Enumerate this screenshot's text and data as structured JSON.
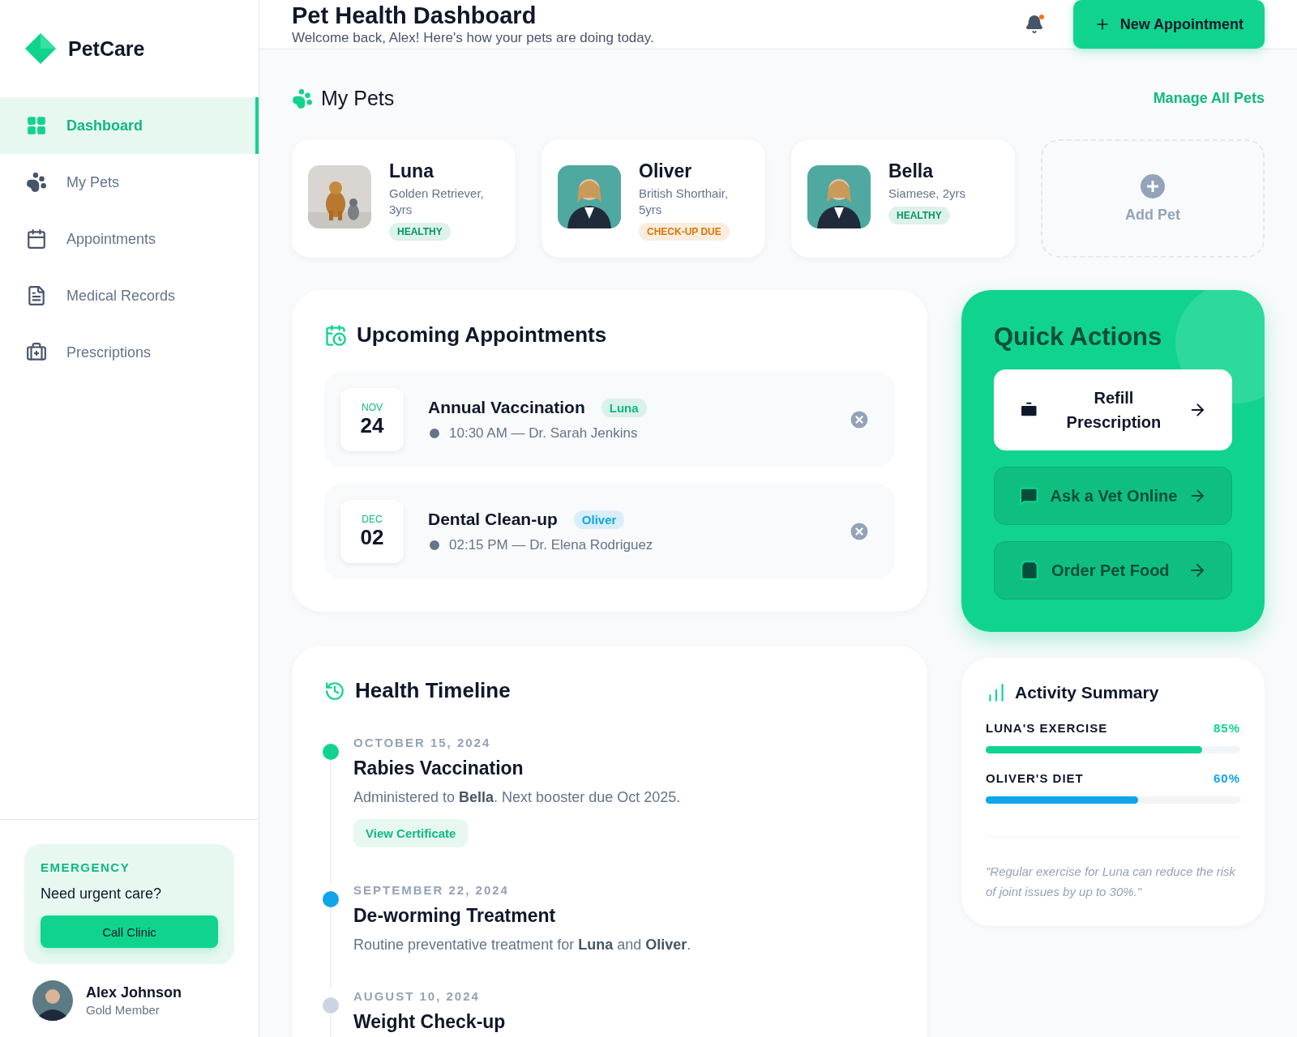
{
  "brand": {
    "name": "PetCare"
  },
  "nav": [
    {
      "label": "Dashboard",
      "selected": true
    },
    {
      "label": "My Pets",
      "selected": false
    },
    {
      "label": "Appointments",
      "selected": false
    },
    {
      "label": "Medical Records",
      "selected": false
    },
    {
      "label": "Prescriptions",
      "selected": false
    }
  ],
  "emergency": {
    "label": "EMERGENCY",
    "text": "Need urgent care?",
    "button": "Call Clinic"
  },
  "user": {
    "name": "Alex Johnson",
    "role": "Gold Member"
  },
  "header": {
    "title": "Pet Health Dashboard",
    "subtitle": "Welcome back, Alex! Here's how your pets are doing today.",
    "notification": true,
    "button": "New Appointment"
  },
  "pets_section": {
    "title": "My Pets",
    "link": "Manage All Pets",
    "add_label": "Add Pet"
  },
  "pets": [
    {
      "name": "Luna",
      "breed": "Golden Retriever, 3yrs",
      "status": "HEALTHY",
      "color": "#059669"
    },
    {
      "name": "Oliver",
      "breed": "British Shorthair, 5yrs",
      "status": "CHECK-UP DUE",
      "color": "#d97706"
    },
    {
      "name": "Bella",
      "breed": "Siamese, 2yrs",
      "status": "HEALTHY",
      "color": "#059669"
    }
  ],
  "appointments": {
    "title": "Upcoming Appointments",
    "items": [
      {
        "month": "NOV",
        "day": "24",
        "title": "Annual Vaccination",
        "pet": "Luna",
        "color": "#10b981",
        "detail": "10:30 AM — Dr. Sarah Jenkins"
      },
      {
        "month": "DEC",
        "day": "02",
        "title": "Dental Clean-up",
        "pet": "Oliver",
        "color": "#0ea5e9",
        "detail": "02:15 PM — Dr. Elena Rodriguez"
      }
    ]
  },
  "quick_actions": {
    "title": "Quick Actions",
    "items": [
      {
        "label": "Refill Prescription",
        "kind": "light"
      },
      {
        "label": "Ask a Vet Online",
        "kind": "dark"
      },
      {
        "label": "Order Pet Food",
        "kind": "dark"
      }
    ]
  },
  "timeline": {
    "title": "Health Timeline",
    "items": [
      {
        "date": "OCTOBER 15, 2024",
        "title": "Rabies Vaccination",
        "text": "Administered to **Bella**. Next booster due Oct 2025.",
        "button": "View Certificate",
        "color": "#10d48e"
      },
      {
        "date": "SEPTEMBER 22, 2024",
        "title": "De-worming Treatment",
        "text": "Routine preventative treatment for **Luna** and **Oliver**.",
        "color": "#0ea5e9"
      },
      {
        "date": "AUGUST 10, 2024",
        "title": "Weight Check-up",
        "color": "#cbd5e1"
      }
    ]
  },
  "activity": {
    "title": "Activity Summary",
    "items": [
      {
        "label": "LUNA'S EXERCISE",
        "reading": "85%",
        "level": 0.85,
        "color": "#10d48e"
      },
      {
        "label": "OLIVER'S DIET",
        "reading": "60%",
        "level": 0.6,
        "color": "#0ea5e9"
      }
    ],
    "quote": "\"Regular exercise for Luna can reduce the risk of joint issues by up to 30%.\""
  }
}
